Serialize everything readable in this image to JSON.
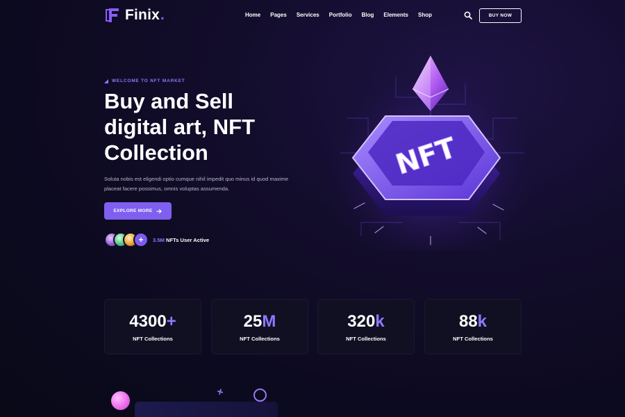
{
  "brand": {
    "name": "Finix",
    "dot": "."
  },
  "nav": {
    "items": [
      "Home",
      "Pages",
      "Services",
      "Portfolio",
      "Blog",
      "Elements",
      "Shop"
    ]
  },
  "header": {
    "buy_label": "BUY NOW",
    "search_icon": "search-icon"
  },
  "hero": {
    "eyebrow": "WELCOME TO NFT MARKET",
    "title_lines": [
      "Buy and Sell",
      "digital art, NFT",
      "Collection"
    ],
    "description_lines": [
      "Soluta nobis est eligendi optio cumque nihil impedit quo minus id quod maxime",
      "placeat facere possimus, omnis voluptas assumenda."
    ],
    "explore_label": "EXPLORE MORE",
    "users_count": "3.5M",
    "users_text": "NFTs User Active",
    "avatar_plus": "+"
  },
  "illustration": {
    "badge_text": "NFT"
  },
  "stats": [
    {
      "value": "4300",
      "suffix": "+",
      "label": "NFT Collections"
    },
    {
      "value": "25",
      "suffix": "M",
      "label": "NFT Collections"
    },
    {
      "value": "320",
      "suffix": "k",
      "label": "NFT Collections"
    },
    {
      "value": "88",
      "suffix": "k",
      "label": "NFT Collections"
    }
  ],
  "colors": {
    "accent": "#7f5ff0",
    "accent_text": "#8f78ff",
    "background": "#0c0a1f"
  }
}
